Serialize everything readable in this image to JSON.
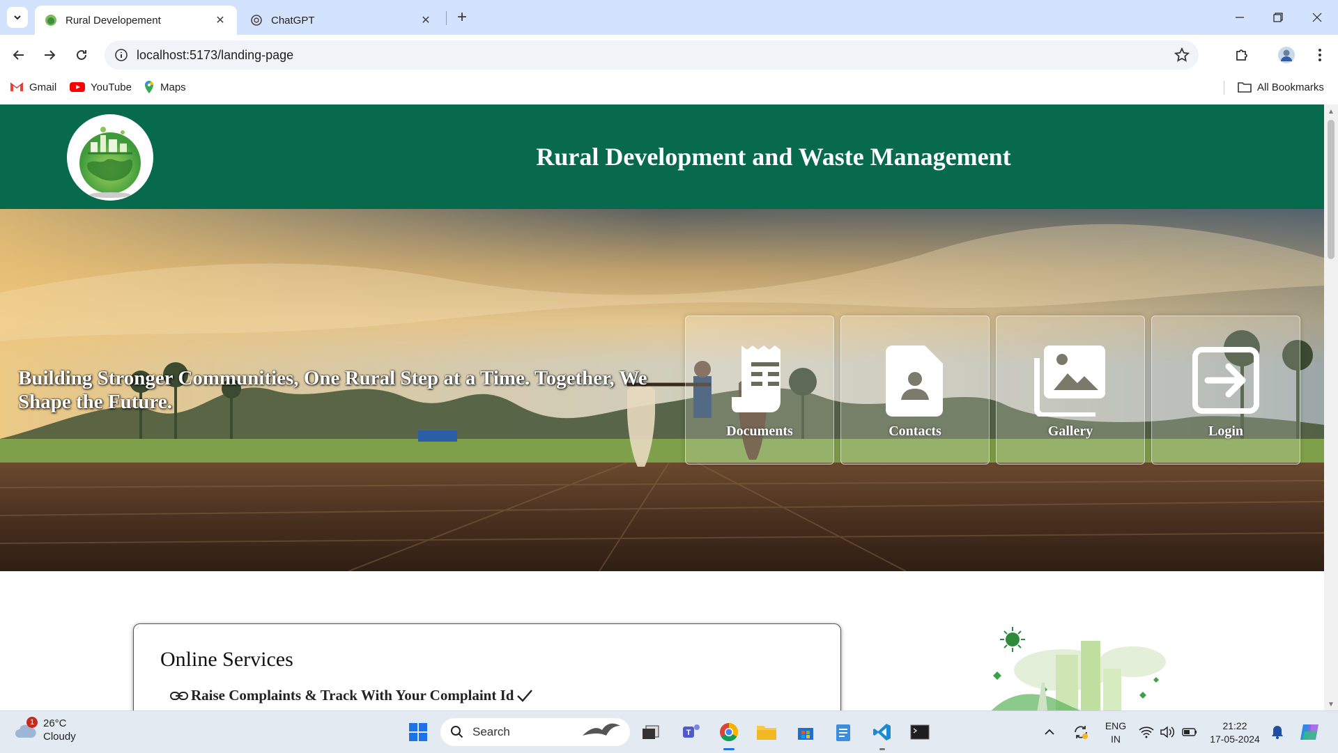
{
  "browser": {
    "tabs": [
      {
        "title": "Rural Developement",
        "active": true
      },
      {
        "title": "ChatGPT",
        "active": false
      }
    ],
    "url": "localhost:5173/landing-page",
    "bookmarks": [
      {
        "label": "Gmail",
        "icon": "gmail-icon"
      },
      {
        "label": "YouTube",
        "icon": "youtube-icon"
      },
      {
        "label": "Maps",
        "icon": "maps-icon"
      }
    ],
    "all_bookmarks_label": "All Bookmarks"
  },
  "site": {
    "title": "Rural Development and Waste Management",
    "brand_color": "#076a4c",
    "hero_tagline": "Building Stronger Communities, One Rural Step at a Time. Together, We Shape the Future.",
    "nav_cards": [
      {
        "label": "Documents",
        "icon": "receipt-icon"
      },
      {
        "label": "Contacts",
        "icon": "contact-file-icon"
      },
      {
        "label": "Gallery",
        "icon": "gallery-icon"
      },
      {
        "label": "Login",
        "icon": "login-icon"
      }
    ],
    "services": {
      "heading": "Online Services",
      "items": [
        {
          "label": "Raise Complaints & Track With Your Complaint Id",
          "icon": "link-icon",
          "suffix_icon": "checkmark-icon"
        }
      ]
    }
  },
  "taskbar": {
    "weather": {
      "temp": "26°C",
      "condition": "Cloudy",
      "badge": "1"
    },
    "search_placeholder": "Search",
    "language": {
      "line1": "ENG",
      "line2": "IN"
    },
    "clock": {
      "time": "21:22",
      "date": "17-05-2024"
    }
  }
}
